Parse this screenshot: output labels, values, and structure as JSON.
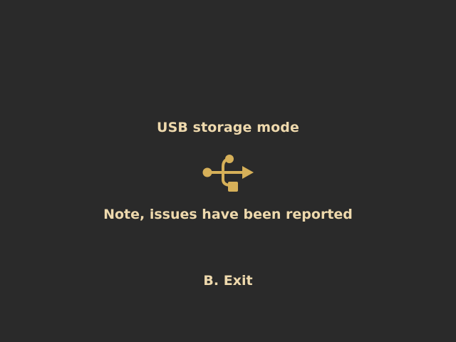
{
  "screen": {
    "title": "USB storage mode",
    "icon": "usb-icon",
    "note": "Note, issues have been reported",
    "exit_label": "B. Exit"
  },
  "colors": {
    "background": "#2a2a2a",
    "text": "#eed9ad",
    "icon": "#d6b059"
  }
}
